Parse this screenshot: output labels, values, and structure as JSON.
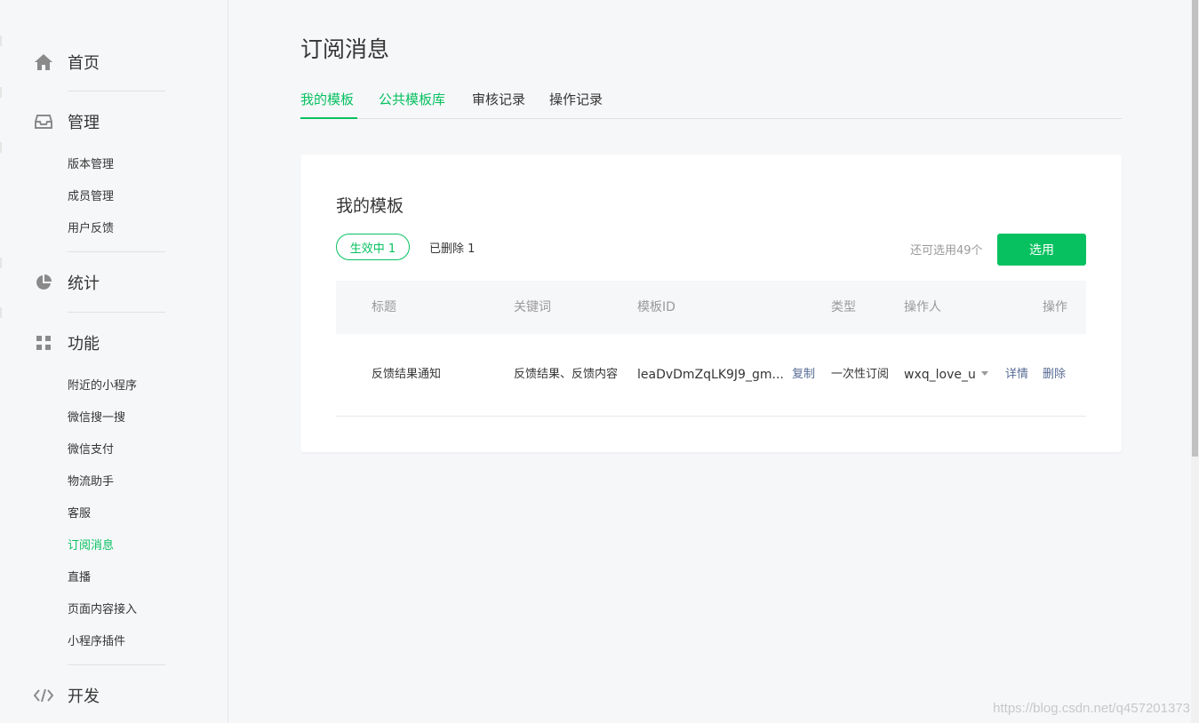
{
  "sidebar": {
    "home": {
      "label": "首页",
      "icon": "home-icon"
    },
    "manage": {
      "label": "管理",
      "icon": "inbox-icon",
      "items": [
        "版本管理",
        "成员管理",
        "用户反馈"
      ]
    },
    "stats": {
      "label": "统计",
      "icon": "pie-chart-icon"
    },
    "features": {
      "label": "功能",
      "icon": "grid-icon",
      "items": [
        "附近的小程序",
        "微信搜一搜",
        "微信支付",
        "物流助手",
        "客服",
        "订阅消息",
        "直播",
        "页面内容接入",
        "小程序插件"
      ],
      "active_item": "订阅消息"
    },
    "dev": {
      "label": "开发",
      "icon": "code-icon"
    }
  },
  "main": {
    "title": "订阅消息",
    "tabs": [
      {
        "label": "我的模板",
        "active": true
      },
      {
        "label": "公共模板库",
        "active": false
      },
      {
        "label": "审核记录",
        "active": false
      },
      {
        "label": "操作记录",
        "active": false
      }
    ]
  },
  "card": {
    "title": "我的模板",
    "filter_active": "生效中  1",
    "filter_deleted": "已删除  1",
    "remain": "还可选用49个",
    "select_button": "选用",
    "table": {
      "headers": [
        "标题",
        "关键词",
        "模板ID",
        "类型",
        "操作人",
        "操作"
      ],
      "rows": [
        {
          "title": "反馈结果通知",
          "keywords": "反馈结果、反馈内容",
          "template_id": "leaDvDmZqLK9J9_gm...",
          "copy": "复制",
          "type": "一次性订阅",
          "operator": "wxq_love_u",
          "detail": "详情",
          "delete": "删除"
        }
      ]
    }
  },
  "watermark": "https://blog.csdn.net/q457201373",
  "colors": {
    "accent": "#07c160",
    "link": "#576b95",
    "text": "#353535",
    "muted": "#9a9a9a"
  }
}
